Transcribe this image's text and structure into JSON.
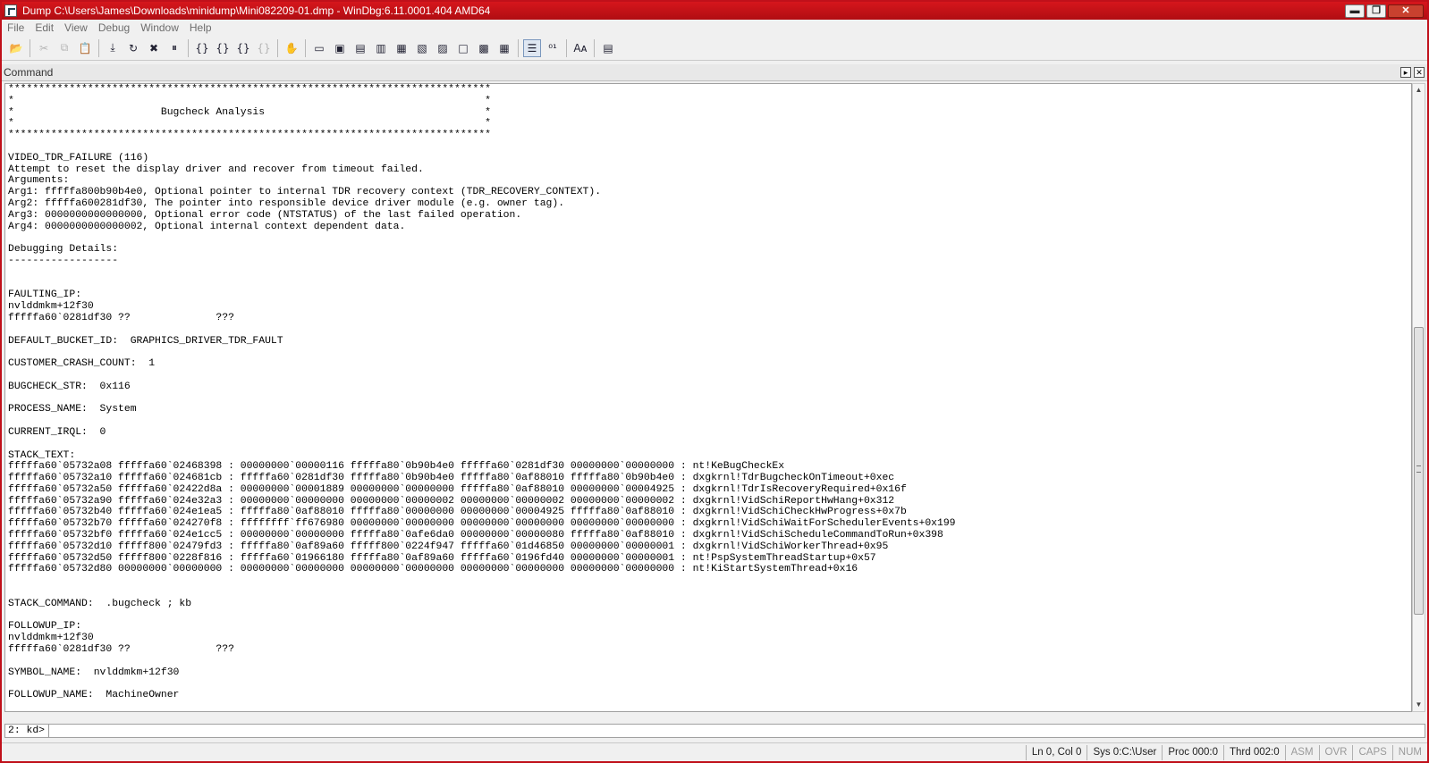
{
  "window": {
    "title": "Dump C:\\Users\\James\\Downloads\\minidump\\Mini082209-01.dmp - WinDbg:6.11.0001.404 AMD64",
    "minimize_label": "▬",
    "maximize_label": "❐",
    "close_label": "✕"
  },
  "menu": [
    "File",
    "Edit",
    "View",
    "Debug",
    "Window",
    "Help"
  ],
  "toolbar": {
    "icons": [
      {
        "name": "open-icon",
        "glyph": "📂",
        "disabled": false
      },
      {
        "sep": true
      },
      {
        "name": "cut-icon",
        "glyph": "✂",
        "disabled": true
      },
      {
        "name": "copy-icon",
        "glyph": "⧉",
        "disabled": true
      },
      {
        "name": "paste-icon",
        "glyph": "📋",
        "disabled": true
      },
      {
        "sep": true
      },
      {
        "name": "go-icon",
        "glyph": "⤓",
        "disabled": false
      },
      {
        "name": "restart-icon",
        "glyph": "↻",
        "disabled": false
      },
      {
        "name": "stop-debugging-icon",
        "glyph": "✖",
        "disabled": false
      },
      {
        "name": "break-icon",
        "glyph": "⏸",
        "disabled": false
      },
      {
        "sep": true
      },
      {
        "name": "step-into-icon",
        "glyph": "{}",
        "disabled": false
      },
      {
        "name": "step-over-icon",
        "glyph": "{}",
        "disabled": false
      },
      {
        "name": "step-out-icon",
        "glyph": "{}",
        "disabled": false
      },
      {
        "name": "run-to-cursor-icon",
        "glyph": "{}",
        "disabled": true
      },
      {
        "sep": true
      },
      {
        "name": "hand-icon",
        "glyph": "✋",
        "disabled": false
      },
      {
        "sep": true
      },
      {
        "name": "command-window-icon",
        "glyph": "▭",
        "disabled": false
      },
      {
        "name": "watch-window-icon",
        "glyph": "▣",
        "disabled": false
      },
      {
        "name": "locals-window-icon",
        "glyph": "▤",
        "disabled": false
      },
      {
        "name": "registers-window-icon",
        "glyph": "▥",
        "disabled": false
      },
      {
        "name": "memory-window-icon",
        "glyph": "▦",
        "disabled": false
      },
      {
        "name": "call-stack-window-icon",
        "glyph": "▧",
        "disabled": false
      },
      {
        "name": "disassembly-window-icon",
        "glyph": "▨",
        "disabled": false
      },
      {
        "name": "scratch-pad-icon",
        "glyph": "□",
        "disabled": false
      },
      {
        "name": "processes-threads-icon",
        "glyph": "▩",
        "disabled": false
      },
      {
        "name": "source-mode-icon",
        "glyph": "▦",
        "disabled": false
      },
      {
        "sep": true
      },
      {
        "name": "source-mode-on-icon",
        "glyph": "☰",
        "disabled": false,
        "active": true
      },
      {
        "name": "binary-mode-icon",
        "glyph": "⁰¹",
        "disabled": false
      },
      {
        "sep": true
      },
      {
        "name": "font-icon",
        "glyph": "Aᴀ",
        "disabled": false
      },
      {
        "sep": true
      },
      {
        "name": "options-icon",
        "glyph": "▤",
        "disabled": false
      }
    ]
  },
  "command_pane": {
    "title": "Command",
    "prompt": "2: kd>",
    "input_value": ""
  },
  "output_text": "*******************************************************************************\n*                                                                             *\n*                        Bugcheck Analysis                                    *\n*                                                                             *\n*******************************************************************************\n\nVIDEO_TDR_FAILURE (116)\nAttempt to reset the display driver and recover from timeout failed.\nArguments:\nArg1: fffffa800b90b4e0, Optional pointer to internal TDR recovery context (TDR_RECOVERY_CONTEXT).\nArg2: fffffa600281df30, The pointer into responsible device driver module (e.g. owner tag).\nArg3: 0000000000000000, Optional error code (NTSTATUS) of the last failed operation.\nArg4: 0000000000000002, Optional internal context dependent data.\n\nDebugging Details:\n------------------\n\n\nFAULTING_IP:\nnvlddmkm+12f30\nfffffa60`0281df30 ??              ???\n\nDEFAULT_BUCKET_ID:  GRAPHICS_DRIVER_TDR_FAULT\n\nCUSTOMER_CRASH_COUNT:  1\n\nBUGCHECK_STR:  0x116\n\nPROCESS_NAME:  System\n\nCURRENT_IRQL:  0\n\nSTACK_TEXT:\nfffffa60`05732a08 fffffa60`02468398 : 00000000`00000116 fffffa80`0b90b4e0 fffffa60`0281df30 00000000`00000000 : nt!KeBugCheckEx\nfffffa60`05732a10 fffffa60`024681cb : fffffa60`0281df30 fffffa80`0b90b4e0 fffffa80`0af88010 fffffa80`0b90b4e0 : dxgkrnl!TdrBugcheckOnTimeout+0xec\nfffffa60`05732a50 fffffa60`02422d8a : 00000000`00001889 00000000`00000000 fffffa80`0af88010 00000000`00004925 : dxgkrnl!TdrIsRecoveryRequired+0x16f\nfffffa60`05732a90 fffffa60`024e32a3 : 00000000`00000000 00000000`00000002 00000000`00000002 00000000`00000002 : dxgkrnl!VidSchiReportHwHang+0x312\nfffffa60`05732b40 fffffa60`024e1ea5 : fffffa80`0af88010 fffffa80`00000000 00000000`00004925 fffffa80`0af88010 : dxgkrnl!VidSchiCheckHwProgress+0x7b\nfffffa60`05732b70 fffffa60`024270f8 : ffffffff`ff676980 00000000`00000000 00000000`00000000 00000000`00000000 : dxgkrnl!VidSchiWaitForSchedulerEvents+0x199\nfffffa60`05732bf0 fffffa60`024e1cc5 : 00000000`00000000 fffffa80`0afe6da0 00000000`00000080 fffffa80`0af88010 : dxgkrnl!VidSchiScheduleCommandToRun+0x398\nfffffa60`05732d10 fffff800`02479fd3 : fffffa80`0af89a60 fffff800`0224f947 fffffa60`01d46850 00000000`00000001 : dxgkrnl!VidSchiWorkerThread+0x95\nfffffa60`05732d50 fffff800`0228f816 : fffffa60`01966180 fffffa80`0af89a60 fffffa60`0196fd40 00000000`00000001 : nt!PspSystemThreadStartup+0x57\nfffffa60`05732d80 00000000`00000000 : 00000000`00000000 00000000`00000000 00000000`00000000 00000000`00000000 : nt!KiStartSystemThread+0x16\n\n\nSTACK_COMMAND:  .bugcheck ; kb\n\nFOLLOWUP_IP:\nnvlddmkm+12f30\nfffffa60`0281df30 ??              ???\n\nSYMBOL_NAME:  nvlddmkm+12f30\n\nFOLLOWUP_NAME:  MachineOwner",
  "status_bar": {
    "ln_col": "Ln 0, Col 0",
    "sys": "Sys 0:C:\\User",
    "proc": "Proc 000:0",
    "thrd": "Thrd 002:0",
    "asm": "ASM",
    "ovr": "OVR",
    "caps": "CAPS",
    "num": "NUM"
  }
}
